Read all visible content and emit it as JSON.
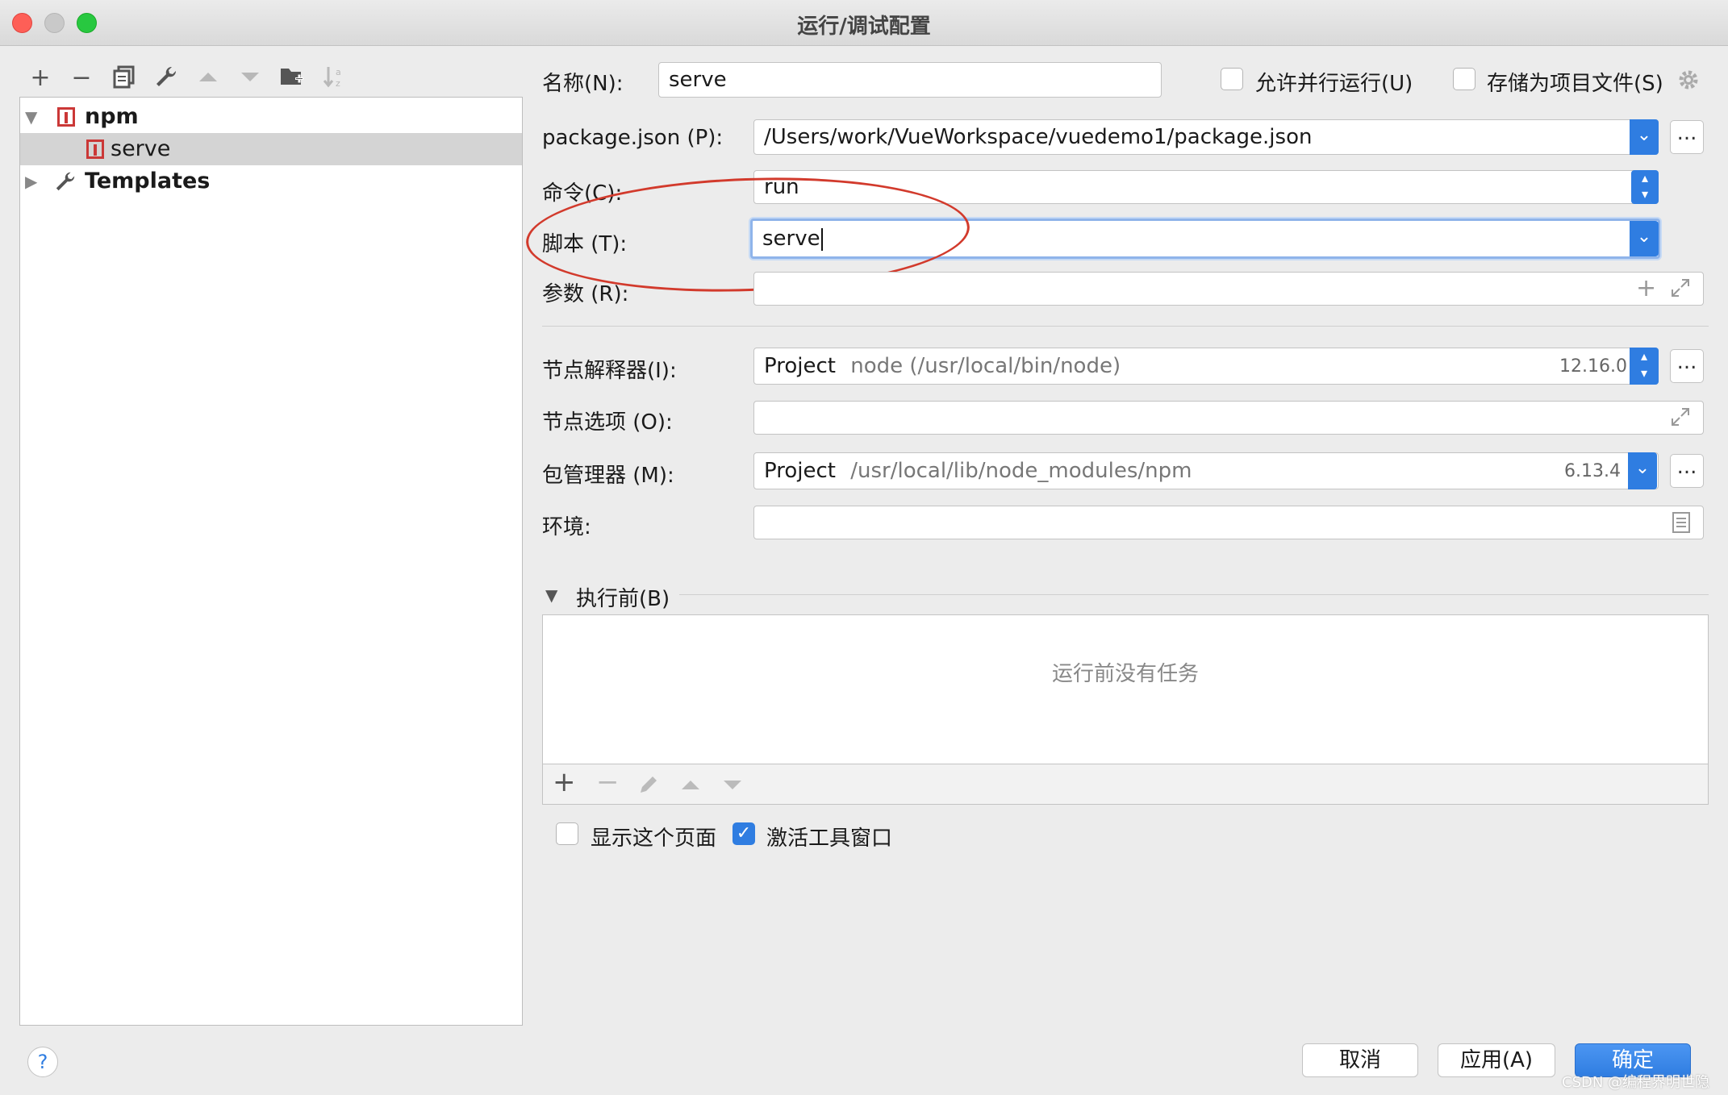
{
  "window": {
    "title": "运行/调试配置"
  },
  "toolbar": {
    "icons": [
      "plus-icon",
      "minus-icon",
      "copy-icon",
      "wrench-icon",
      "arrow-up-icon",
      "arrow-down-icon",
      "new-folder-icon",
      "sort-icon"
    ]
  },
  "tree": {
    "npm_label": "npm",
    "serve_label": "serve",
    "templates_label": "Templates"
  },
  "form": {
    "name_label": "名称(N):",
    "name_value": "serve",
    "allow_parallel_label": "允许并行运行(U)",
    "allow_parallel_checked": false,
    "store_as_file_label": "存储为项目文件(S)",
    "store_as_file_checked": false,
    "package_json_label": "package.json (P):",
    "package_json_value": "/Users/work/VueWorkspace/vuedemo1/package.json",
    "command_label": "命令(C):",
    "command_value": "run",
    "script_label": "脚本 (T):",
    "script_value": "serve",
    "args_label": "参数 (R):",
    "args_value": "",
    "node_interpreter_label": "节点解释器(I):",
    "node_interpreter_project": "Project",
    "node_interpreter_path": "node (/usr/local/bin/node)",
    "node_interpreter_version": "12.16.0",
    "node_options_label": "节点选项 (O):",
    "node_options_value": "",
    "package_manager_label": "包管理器 (M):",
    "package_manager_project": "Project",
    "package_manager_path": "/usr/local/lib/node_modules/npm",
    "package_manager_version": "6.13.4",
    "env_label": "环境:",
    "env_value": "",
    "dots": "..."
  },
  "before_launch": {
    "label": "执行前(B)",
    "empty_text": "运行前没有任务"
  },
  "options": {
    "show_page_label": "显示这个页面",
    "show_page_checked": false,
    "activate_tool_label": "激活工具窗口",
    "activate_tool_checked": true
  },
  "buttons": {
    "help": "?",
    "cancel": "取消",
    "apply": "应用(A)",
    "ok": "确定"
  },
  "watermark": "CSDN @编程界明世隐"
}
